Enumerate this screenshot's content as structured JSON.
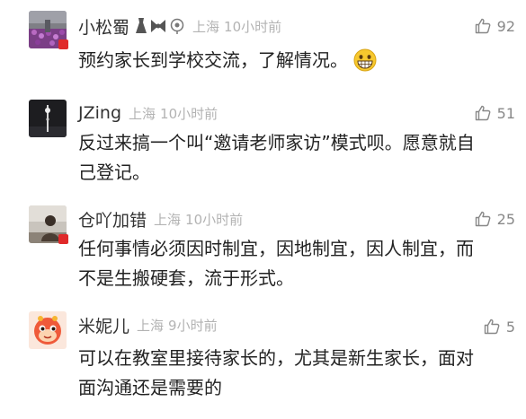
{
  "comments": [
    {
      "name": "小松蜀",
      "location": "上海",
      "time": "10小时前",
      "likes": "92",
      "text": "预约家长到学校交流，了解情况。",
      "avatar": "purple-flower-field-photo",
      "badges": [
        "dress-badge-icon",
        "bow-badge-icon",
        "flower-badge-icon"
      ],
      "emoji": "grinning-face-emoji"
    },
    {
      "name": "JZing",
      "location": "上海",
      "time": "10小时前",
      "likes": "51",
      "text": "反过来搞一个叫“邀请老师家访”模式呗。愿意就自己登记。",
      "avatar": "night-tower-photo"
    },
    {
      "name": "仓吖加错",
      "location": "上海",
      "time": "10小时前",
      "likes": "25",
      "text": "任何事情必须因时制宜，因地制宜，因人制宜，而不是生搬硬套，流于形式。",
      "avatar": "person-outdoor-photo"
    },
    {
      "name": "米妮儿",
      "location": "上海",
      "time": "9小时前",
      "likes": "5",
      "text": "可以在教室里接待家长的，尤其是新生家长，面对面沟通还是需要的",
      "avatar": "cartoon-snake-avatar"
    }
  ],
  "colors": {
    "name": "#333333",
    "meta": "#b3b3b3",
    "text": "#222222",
    "like": "#888888",
    "flag": "#e02a2a"
  }
}
